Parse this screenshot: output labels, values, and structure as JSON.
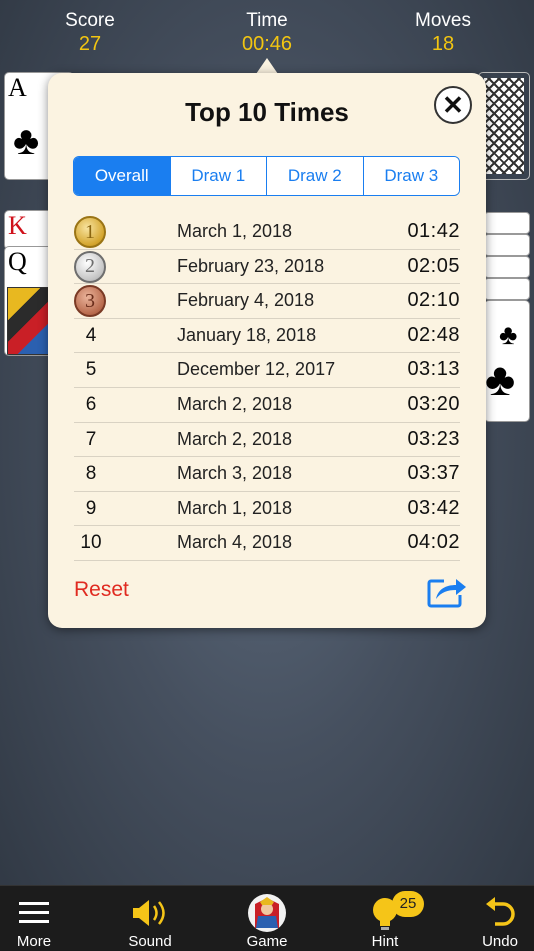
{
  "hud": {
    "score_label": "Score",
    "score_value": "27",
    "time_label": "Time",
    "time_value": "00:46",
    "moves_label": "Moves",
    "moves_value": "18"
  },
  "cards": {
    "left_top_rank": "A",
    "left_king_rank": "K",
    "left_queen_rank": "Q",
    "suit_club": "♣"
  },
  "dialog": {
    "title": "Top 10 Times",
    "close_symbol": "✕",
    "tabs": [
      "Overall",
      "Draw 1",
      "Draw 2",
      "Draw 3"
    ],
    "active_tab": 0,
    "rows": [
      {
        "rank": "1",
        "date": "March 1, 2018",
        "time": "01:42"
      },
      {
        "rank": "2",
        "date": "February 23, 2018",
        "time": "02:05"
      },
      {
        "rank": "3",
        "date": "February 4, 2018",
        "time": "02:10"
      },
      {
        "rank": "4",
        "date": "January 18, 2018",
        "time": "02:48"
      },
      {
        "rank": "5",
        "date": "December 12, 2017",
        "time": "03:13"
      },
      {
        "rank": "6",
        "date": "March 2, 2018",
        "time": "03:20"
      },
      {
        "rank": "7",
        "date": "March 2, 2018",
        "time": "03:23"
      },
      {
        "rank": "8",
        "date": "March 3, 2018",
        "time": "03:37"
      },
      {
        "rank": "9",
        "date": "March 1, 2018",
        "time": "03:42"
      },
      {
        "rank": "10",
        "date": "March 4, 2018",
        "time": "04:02"
      }
    ],
    "reset_label": "Reset",
    "share_icon": "share-icon"
  },
  "tabbar": {
    "more_label": "More",
    "sound_label": "Sound",
    "game_label": "Game",
    "hint_label": "Hint",
    "hint_badge": "25",
    "undo_label": "Undo"
  },
  "colors": {
    "accent": "#1a7ef0",
    "reset": "#e02a20",
    "hud_value": "#f2c511",
    "dialog_bg": "#fbf3e1"
  }
}
